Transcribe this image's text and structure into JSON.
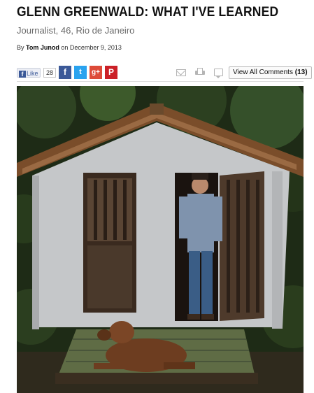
{
  "article": {
    "headline": "GLENN GREENWALD: WHAT I'VE LEARNED",
    "dek": "Journalist, 46, Rio de Janeiro",
    "byline_prefix": "By",
    "author": "Tom Junod",
    "date_text": "on December 9, 2013"
  },
  "share": {
    "like_label": "Like",
    "like_count": "28",
    "facebook_glyph": "f",
    "twitter_glyph": "t",
    "googleplus_glyph": "g+",
    "pinterest_glyph": "P",
    "comments_label": "View All Comments",
    "comments_count": "(13)",
    "icons": [
      "facebook-like-icon",
      "facebook-icon",
      "twitter-icon",
      "google-plus-icon",
      "pinterest-icon",
      "email-icon",
      "print-icon",
      "comment-icon"
    ],
    "colors": {
      "facebook": "#3b5998",
      "twitter": "#2aa3ef",
      "googleplus": "#dd4b39",
      "pinterest": "#cb2027"
    }
  }
}
